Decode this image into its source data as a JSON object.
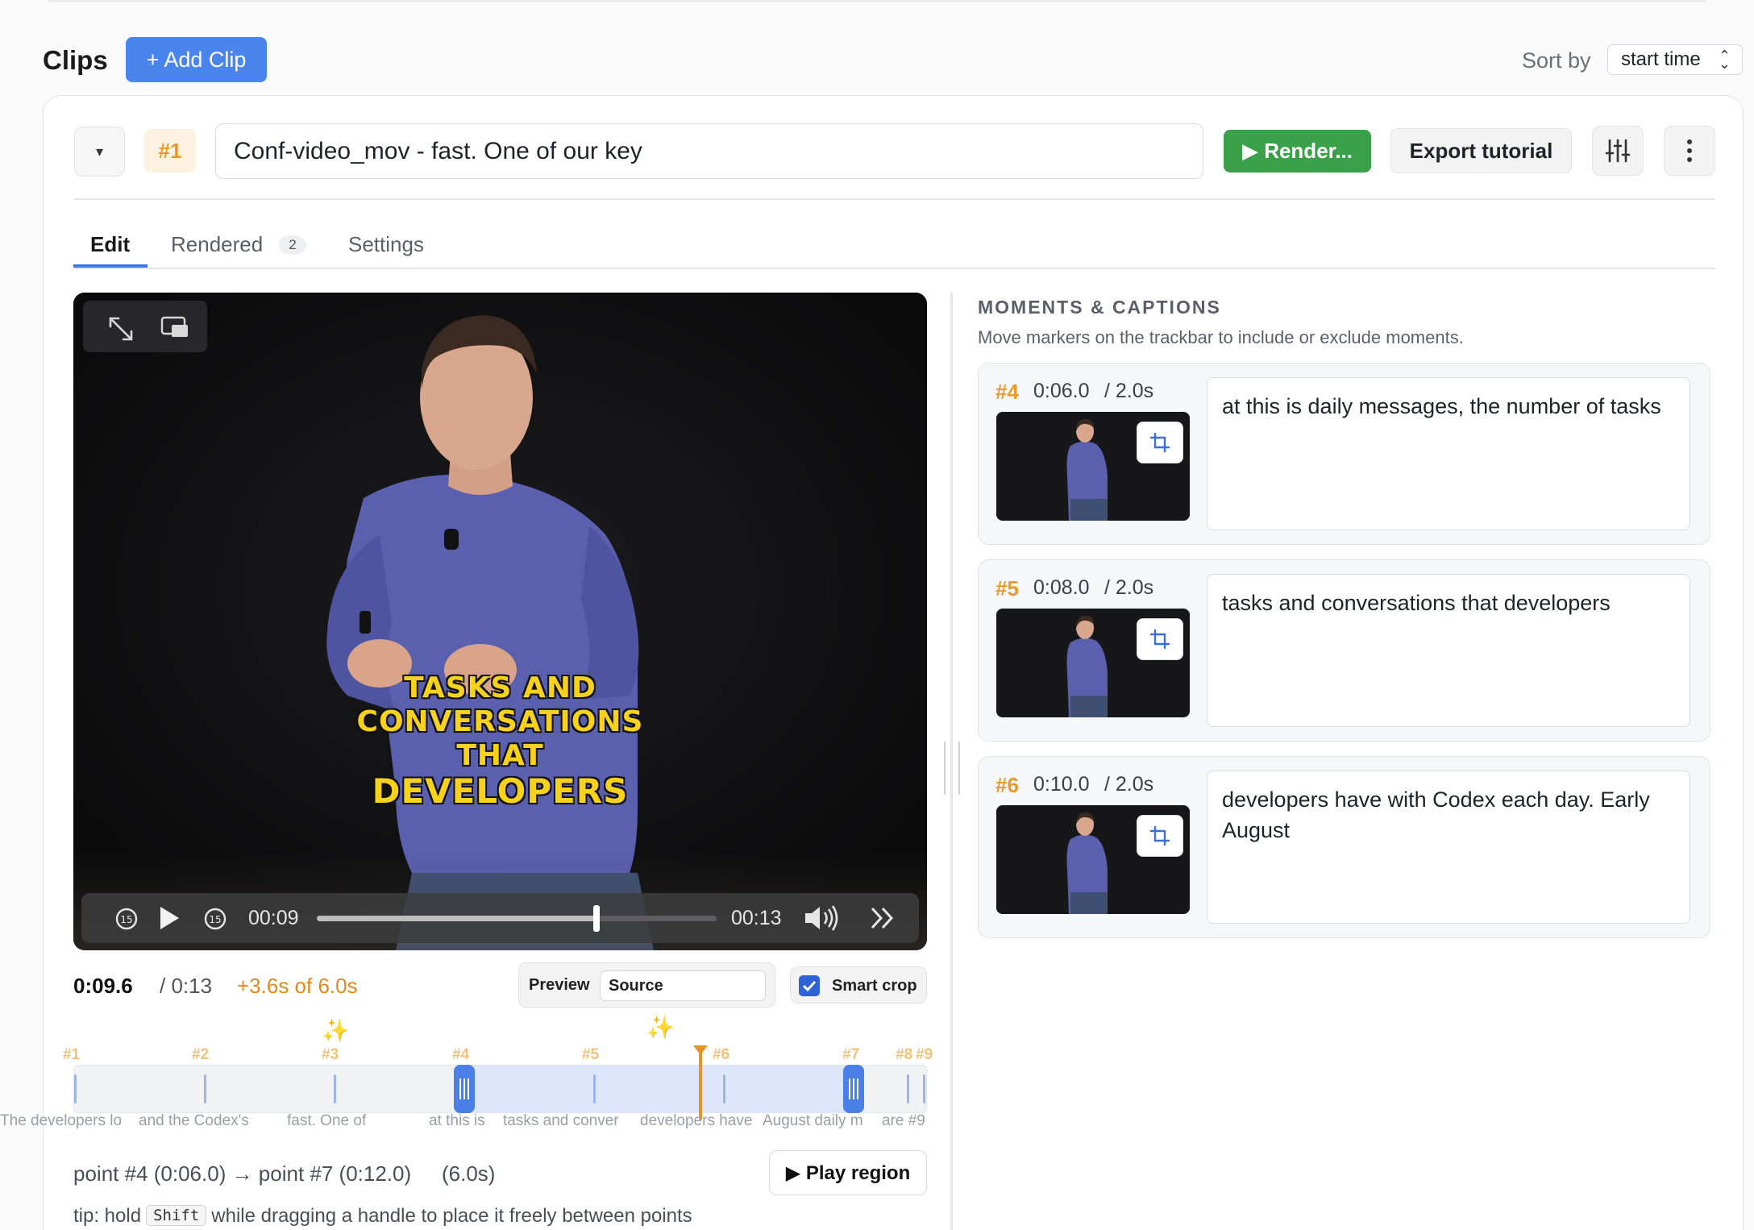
{
  "header": {
    "title": "Clips",
    "add_clip_label": "+ Add Clip",
    "sort_label": "Sort by",
    "sort_value": "start time"
  },
  "clip": {
    "badge": "#1",
    "name": "Conf-video_mov - fast. One of our key",
    "render_label": "▶ Render...",
    "export_label": "Export tutorial"
  },
  "tabs": {
    "edit": "Edit",
    "rendered": "Rendered",
    "rendered_count": "2",
    "settings": "Settings"
  },
  "video": {
    "caption_lines": [
      "TASKS AND",
      "CONVERSATIONS",
      "THAT",
      "DEVELOPERS"
    ],
    "current": "00:09",
    "duration": "00:13",
    "progress_fraction": 0.7
  },
  "timing": {
    "current": "0:09.6",
    "total": "/ 0:13",
    "delta": "+3.6s of 6.0s"
  },
  "preview": {
    "label": "Preview",
    "source": "Source"
  },
  "smart_crop": {
    "label": "Smart crop",
    "checked": true
  },
  "trackbar": {
    "points": [
      "#1",
      "#2",
      "#3",
      "#4",
      "#5",
      "#6",
      "#7",
      "#8",
      "#9"
    ],
    "snippets": [
      "The developers lo",
      "and the Codex's",
      "fast. One of",
      "at this is",
      "tasks and conver",
      "developers have",
      "August daily m",
      "are #9"
    ]
  },
  "range": {
    "text": "point #4 (0:06.0) → point #7 (0:12.0)",
    "duration": "(6.0s)",
    "play_label": "▶ Play region"
  },
  "tip": {
    "before": "tip: hold",
    "key": "Shift",
    "after": "while dragging a handle to place it freely between points"
  },
  "moments_panel": {
    "title": "MOMENTS & CAPTIONS",
    "subtitle": "Move markers on the trackbar to include or exclude moments.",
    "items": [
      {
        "num": "#4",
        "time": "0:06.0",
        "dur": "/ 2.0s",
        "text": "at this is daily messages, the number of tasks"
      },
      {
        "num": "#5",
        "time": "0:08.0",
        "dur": "/ 2.0s",
        "text": "tasks and conversations that developers"
      },
      {
        "num": "#6",
        "time": "0:10.0",
        "dur": "/ 2.0s",
        "text": "developers have with Codex each day. Early August"
      }
    ]
  },
  "colors": {
    "accent_blue": "#4a85ee",
    "render_green": "#3aa04a",
    "point_orange": "#e89a2d",
    "caption_yellow": "#f7d21c"
  }
}
